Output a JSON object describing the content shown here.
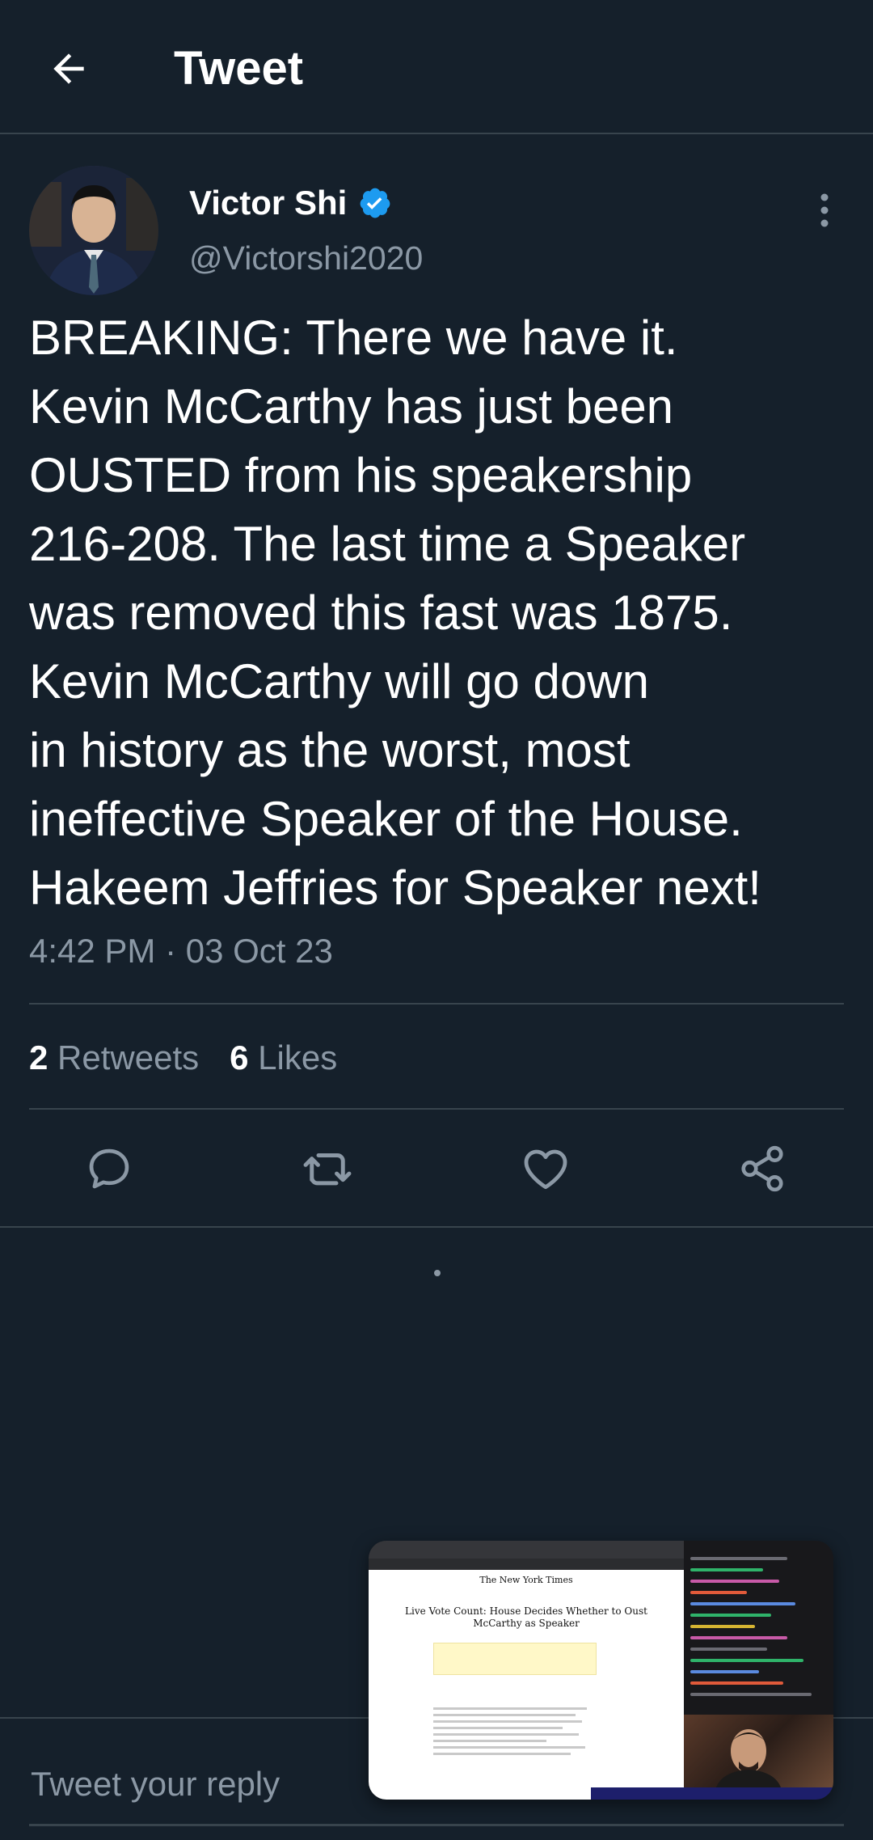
{
  "header": {
    "title": "Tweet",
    "back_icon": "arrow-left-icon"
  },
  "author": {
    "name": "Victor Shi",
    "handle": "@Victorshi2020",
    "verified": true,
    "verified_color": "#1d9bf0"
  },
  "tweet": {
    "text": "BREAKING: There we have it.\nKevin McCarthy has just been\nOUSTED from his speakership\n216-208. The last time a Speaker\nwas removed this fast was 1875.\nKevin McCarthy will go down\nin history as the worst, most\nineffective Speaker of the House.\nHakeem Jeffries for Speaker next!",
    "time": "4:42 PM · 03 Oct 23"
  },
  "stats": {
    "retweets_count": "2",
    "retweets_label": "Retweets",
    "likes_count": "6",
    "likes_label": "Likes"
  },
  "actions": [
    {
      "icon": "reply-icon"
    },
    {
      "icon": "retweet-icon"
    },
    {
      "icon": "like-icon"
    },
    {
      "icon": "share-icon"
    }
  ],
  "reply": {
    "placeholder": "Tweet your reply"
  },
  "video_overlay": {
    "masthead": "The New York Times",
    "headline": "Live Vote Count: House Decides Whether to Oust McCarthy as Speaker"
  },
  "colors": {
    "background": "#15202b",
    "border": "#38444d",
    "secondary_text": "#8b98a5",
    "accent": "#1d9bf0"
  }
}
